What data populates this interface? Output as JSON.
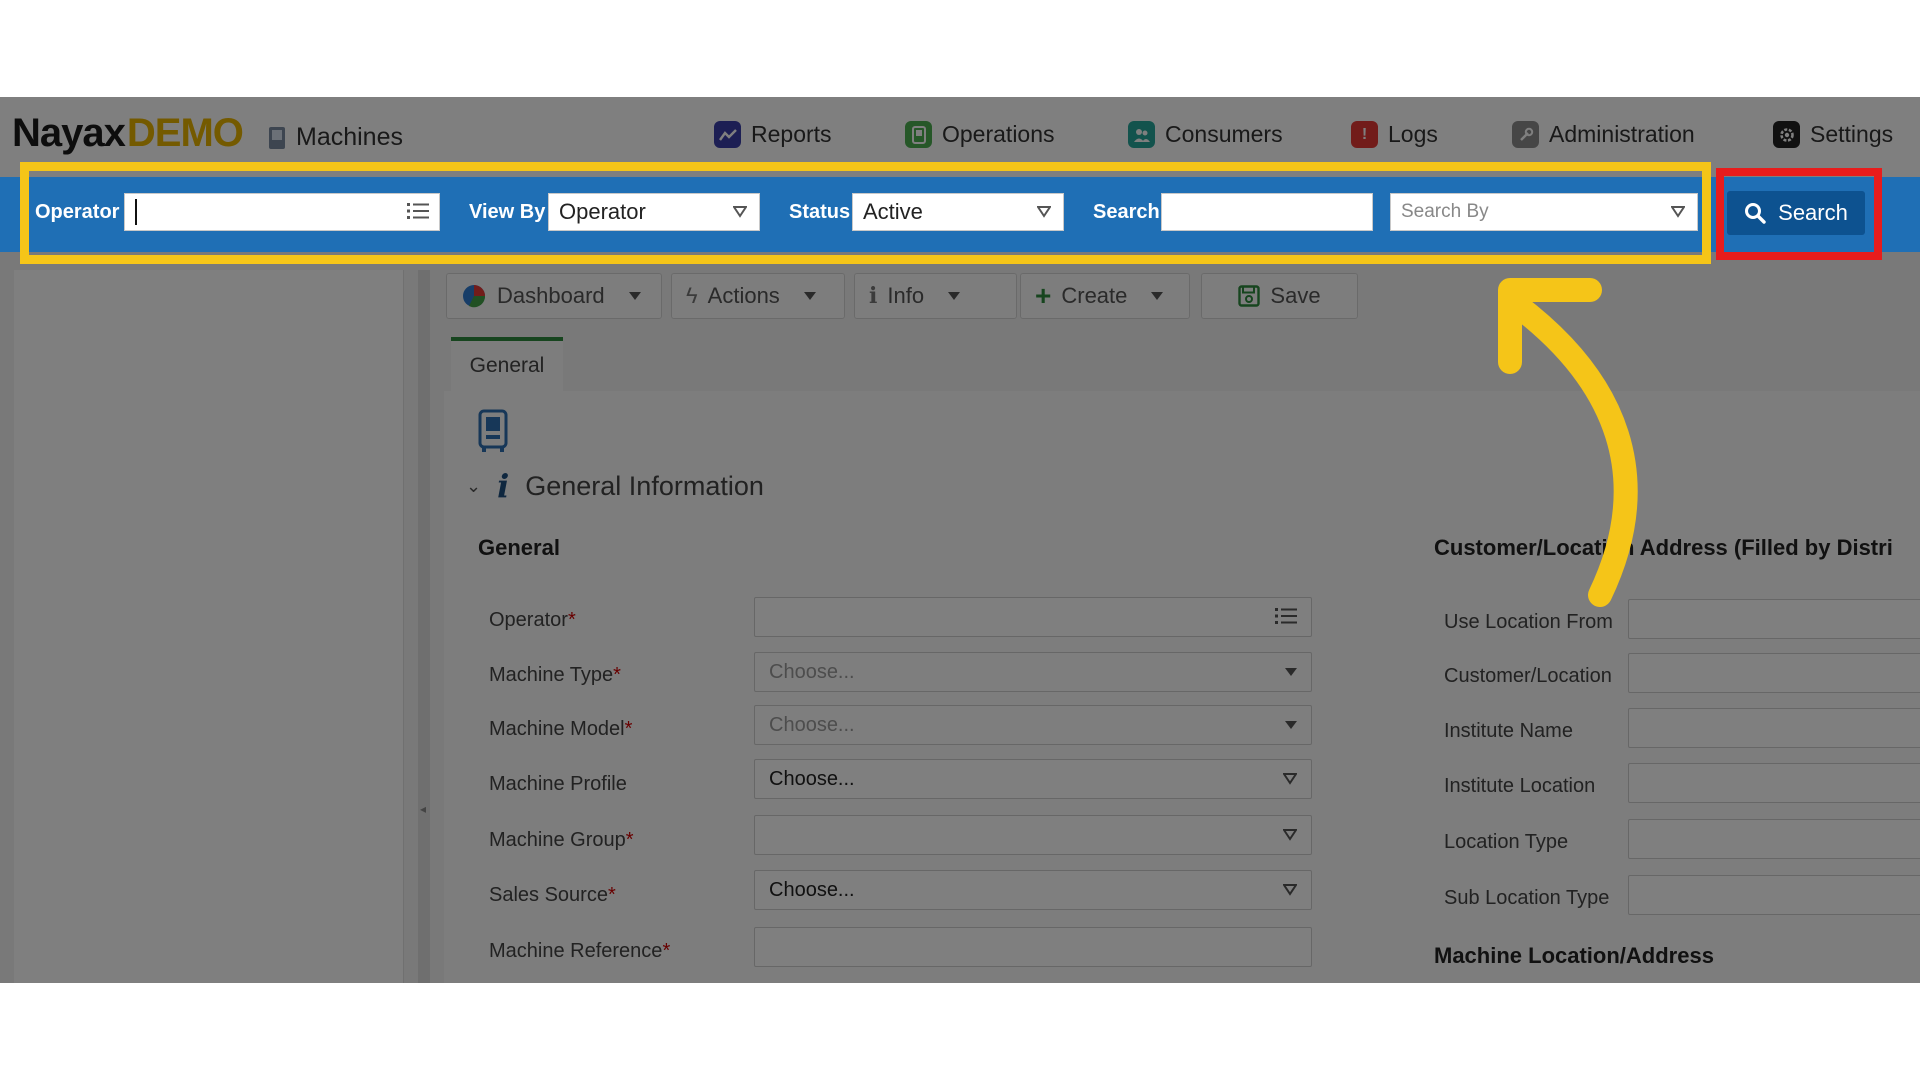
{
  "header": {
    "logo_main": "Nayax",
    "logo_suffix": "DEMO",
    "module_title": "Machines",
    "nav": [
      {
        "label": "Reports",
        "icon": "reports-icon",
        "color": "#3b3fa8"
      },
      {
        "label": "Operations",
        "icon": "operations-icon",
        "color": "#4caf50"
      },
      {
        "label": "Consumers",
        "icon": "consumers-icon",
        "color": "#26a69a"
      },
      {
        "label": "Logs",
        "icon": "logs-icon",
        "color": "#e53935"
      },
      {
        "label": "Administration",
        "icon": "administration-icon",
        "color": "#8d8d8d"
      },
      {
        "label": "Settings",
        "icon": "gear-icon",
        "color": "#222222"
      }
    ]
  },
  "searchbar": {
    "operator_label": "Operator",
    "operator_value": "",
    "viewby_label": "View By",
    "viewby_value": "Operator",
    "status_label": "Status",
    "status_value": "Active",
    "search_label": "Search",
    "search_value": "",
    "searchby_placeholder": "Search By",
    "search_button": "Search",
    "bar_color": "#1f6fb5",
    "button_color": "#0d5290"
  },
  "toolbar": {
    "dashboard": "Dashboard",
    "actions": "Actions",
    "info": "Info",
    "create": "Create",
    "save": "Save"
  },
  "tabs": {
    "general": "General"
  },
  "section": {
    "title": "General Information"
  },
  "general": {
    "heading": "General",
    "fields": [
      {
        "label": "Operator",
        "required": "*",
        "value": "",
        "kind": "list"
      },
      {
        "label": "Machine Type",
        "required": "*",
        "value": "Choose...",
        "kind": "solid",
        "disabled": true
      },
      {
        "label": "Machine Model",
        "required": "*",
        "value": "Choose...",
        "kind": "solid",
        "disabled": true
      },
      {
        "label": "Machine Profile",
        "required": "",
        "value": "Choose...",
        "kind": "outline"
      },
      {
        "label": "Machine Group",
        "required": "*",
        "value": "",
        "kind": "outline"
      },
      {
        "label": "Sales Source",
        "required": "*",
        "value": "Choose...",
        "kind": "outline"
      },
      {
        "label": "Machine Reference",
        "required": "*",
        "value": "",
        "kind": "text"
      }
    ]
  },
  "customer": {
    "heading": "Customer/Location Address (Filled by Distri",
    "fields": [
      {
        "label": "Use Location From"
      },
      {
        "label": "Customer/Location"
      },
      {
        "label": "Institute Name"
      },
      {
        "label": "Institute Location"
      },
      {
        "label": "Location Type"
      },
      {
        "label": "Sub Location Type"
      }
    ],
    "machine_location_heading": "Machine Location/Address"
  },
  "annotations": {
    "highlight_box_color": "#f5c518",
    "search_button_box_color": "#e81c1c",
    "arrow_color": "#f5c518"
  }
}
